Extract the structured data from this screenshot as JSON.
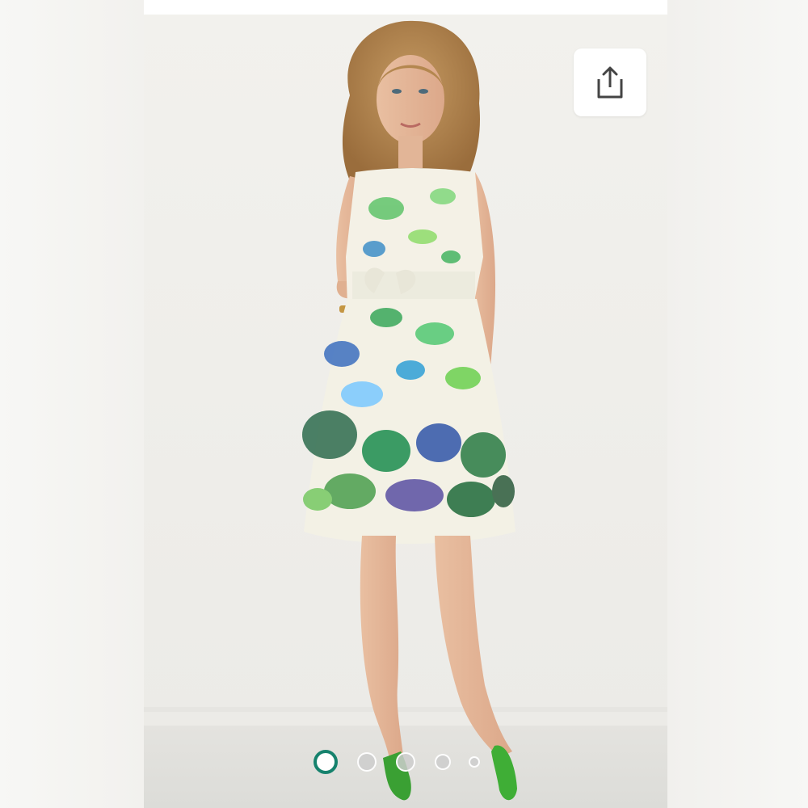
{
  "viewer": {
    "image_description_icon": "product-photo",
    "colors": {
      "active_dot": "#16826d",
      "backdrop": "#f0efeb"
    }
  },
  "share_button": {
    "icon": "share-icon"
  },
  "carousel": {
    "total": 5,
    "active_index": 0
  }
}
